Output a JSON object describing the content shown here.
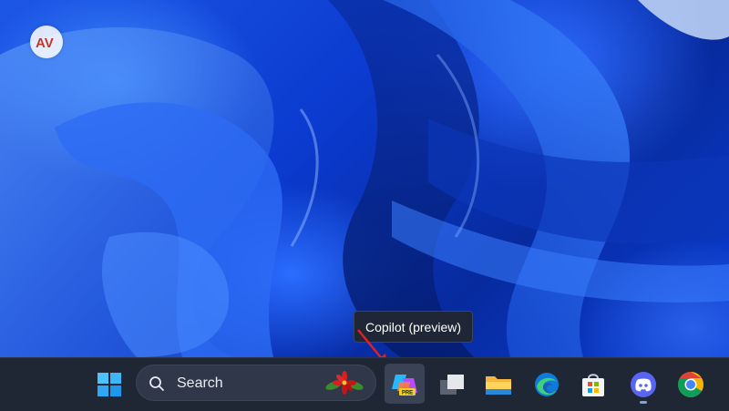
{
  "wallpaper": {
    "name": "windows-11-bloom"
  },
  "watermark": {
    "text": "AV"
  },
  "tooltip": {
    "text": "Copilot (preview)"
  },
  "taskbar": {
    "start": {
      "icon": "windows-logo-icon"
    },
    "search": {
      "label": "Search",
      "icon": "search-icon",
      "highlight_icon": "poinsettia-icon"
    },
    "copilot": {
      "icon": "copilot-icon",
      "badge": "PRE"
    },
    "apps": [
      {
        "name": "task-view",
        "icon": "task-view-icon"
      },
      {
        "name": "file-explorer",
        "icon": "folder-icon"
      },
      {
        "name": "edge",
        "icon": "edge-icon"
      },
      {
        "name": "microsoft-store",
        "icon": "store-icon"
      },
      {
        "name": "discord",
        "icon": "discord-icon"
      },
      {
        "name": "chrome",
        "icon": "chrome-icon"
      }
    ]
  },
  "colors": {
    "taskbar": "#1f2634",
    "annotation_arrow": "#e0211f",
    "wallpaper_primary": "#1d57e6"
  }
}
